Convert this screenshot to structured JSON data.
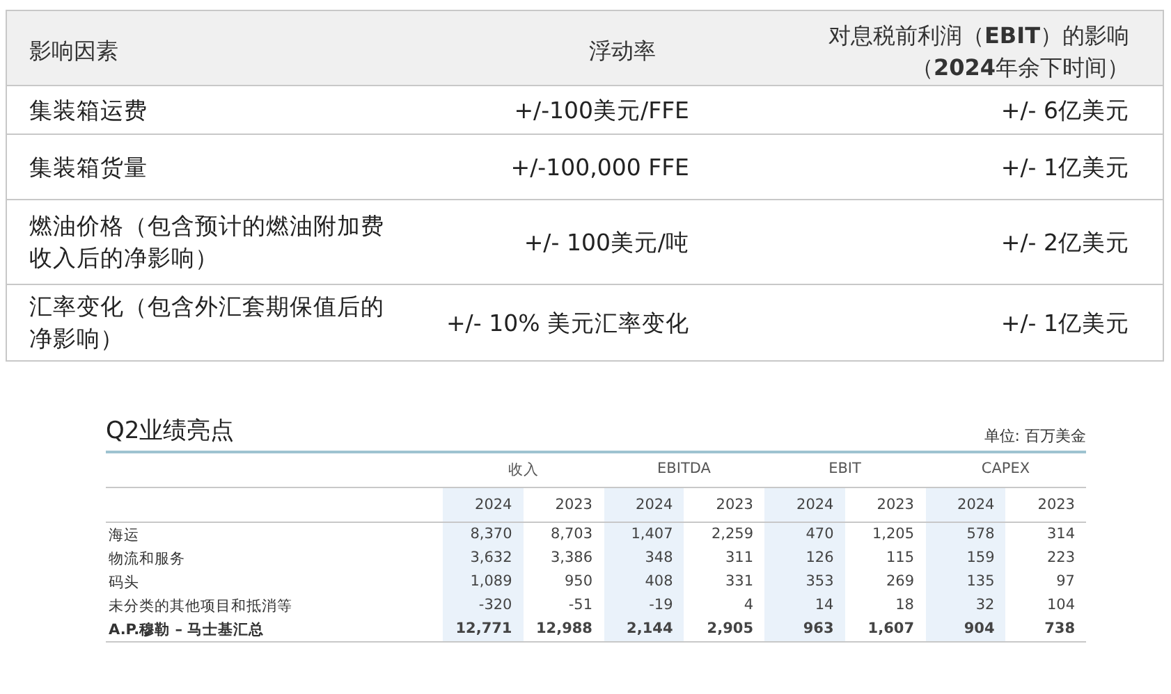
{
  "sensitivity_table": {
    "columns": [
      {
        "lines": [
          "影响因素"
        ]
      },
      {
        "lines": [
          "浮动率"
        ]
      },
      {
        "lines": [
          "对息税前利润（**EBIT**）的影响",
          "（**2024**年余下时间）"
        ]
      }
    ],
    "rows": [
      {
        "factor": "集装箱运费",
        "change": "+/-100美元/FFE",
        "impact": "+/- 6亿美元"
      },
      {
        "factor": "集装箱货量",
        "change": "+/-100,000 FFE",
        "impact": "+/- 1亿美元"
      },
      {
        "factor": "燃油价格（包含预计的燃油附加费收入后的净影响）",
        "change": "+/- 100美元/吨",
        "impact": "+/- 2亿美元"
      },
      {
        "factor": "汇率变化（包含外汇套期保值后的净影响）",
        "change": "+/- 10% 美元汇率变化",
        "impact": "+/- 1亿美元"
      }
    ]
  },
  "highlights": {
    "title": "Q2业绩亮点",
    "unit": "单位: 百万美金",
    "groups": [
      "收入",
      "EBITDA",
      "EBIT",
      "CAPEX"
    ],
    "years": [
      {
        "label": "2024",
        "highlighted": true
      },
      {
        "label": "2023",
        "highlighted": false
      },
      {
        "label": "2024",
        "highlighted": true
      },
      {
        "label": "2023",
        "highlighted": false
      },
      {
        "label": "2024",
        "highlighted": true
      },
      {
        "label": "2023",
        "highlighted": false
      },
      {
        "label": "2024",
        "highlighted": true
      },
      {
        "label": "2023",
        "highlighted": false
      }
    ],
    "rows": [
      {
        "kind": "item",
        "label": "海运",
        "values": [
          "8,370",
          "8,703",
          "1,407",
          "2,259",
          "470",
          "1,205",
          "578",
          "314"
        ]
      },
      {
        "kind": "item",
        "label": "物流和服务",
        "values": [
          "3,632",
          "3,386",
          "348",
          "311",
          "126",
          "115",
          "159",
          "223"
        ]
      },
      {
        "kind": "item",
        "label": "码头",
        "values": [
          "1,089",
          "950",
          "408",
          "331",
          "353",
          "269",
          "135",
          "97"
        ]
      },
      {
        "kind": "item",
        "label": "未分类的其他项目和抵消等",
        "values": [
          "-320",
          "-51",
          "-19",
          "4",
          "14",
          "18",
          "32",
          "104"
        ]
      },
      {
        "kind": "total",
        "label": "A.P.穆勒 – 马士基汇总",
        "values": [
          "12,771",
          "12,988",
          "2,144",
          "2,905",
          "963",
          "1,607",
          "904",
          "738"
        ]
      }
    ]
  }
}
